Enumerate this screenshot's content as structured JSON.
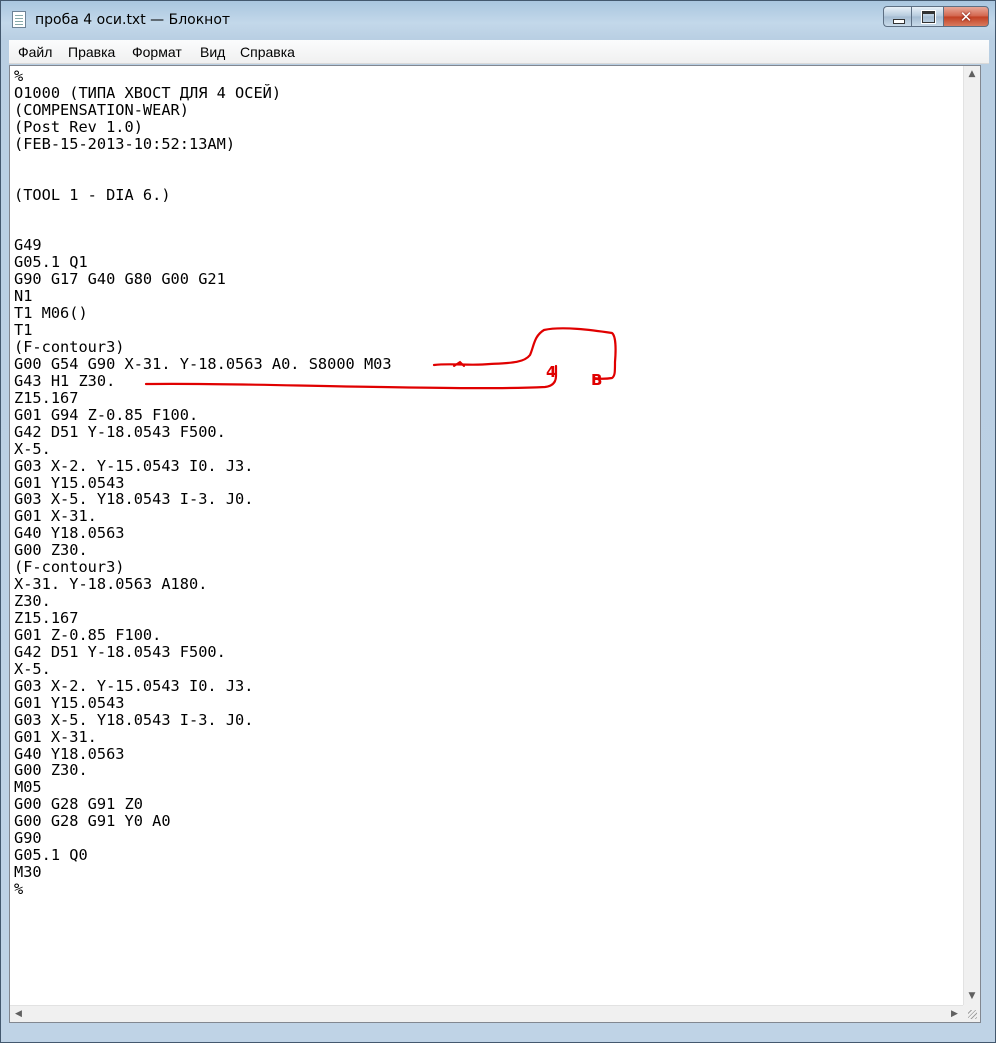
{
  "window": {
    "title": "проба 4 оси.txt — Блокнот"
  },
  "menu": {
    "items": [
      "Файл",
      "Правка",
      "Формат",
      "Вид",
      "Справка"
    ]
  },
  "editor": {
    "lines": [
      "%",
      "O1000 (ТИПА ХВОСТ ДЛЯ 4 ОСЕЙ)",
      "(COMPENSATION-WEAR)",
      "(Post Rev 1.0)",
      "(FEB-15-2013-10:52:13AM)",
      "",
      "",
      "(TOOL 1 - DIA 6.)",
      "",
      "",
      "G49",
      "G05.1 Q1",
      "G90 G17 G40 G80 G00 G21",
      "N1",
      "T1 M06()",
      "T1",
      "(F-contour3)",
      "G00 G54 G90 X-31. Y-18.0563 A0. S8000 M03",
      "G43 H1 Z30.",
      "Z15.167",
      "G01 G94 Z-0.85 F100.",
      "G42 D51 Y-18.0543 F500.",
      "X-5.",
      "G03 X-2. Y-15.0543 I0. J3.",
      "G01 Y15.0543",
      "G03 X-5. Y18.0543 I-3. J0.",
      "G01 X-31.",
      "G40 Y18.0563",
      "G00 Z30.",
      "(F-contour3)",
      "X-31. Y-18.0563 A180.",
      "Z30.",
      "Z15.167",
      "G01 Z-0.85 F100.",
      "G42 D51 Y-18.0543 F500.",
      "X-5.",
      "G03 X-2. Y-15.0543 I0. J3.",
      "G01 Y15.0543",
      "G03 X-5. Y18.0543 I-3. J0.",
      "G01 X-31.",
      "G40 Y18.0563",
      "G00 Z30.",
      "M05",
      "G00 G28 G91 Z0",
      "G00 G28 G91 Y0 A0",
      "G90",
      "G05.1 Q0",
      "M30",
      "%"
    ]
  },
  "annotation": {
    "color": "#e00000",
    "labels": [
      "4",
      "B"
    ]
  },
  "icons": {
    "title": "notepad-icon",
    "minimize": "minimize-icon",
    "maximize": "maximize-icon",
    "close": "close-icon"
  }
}
